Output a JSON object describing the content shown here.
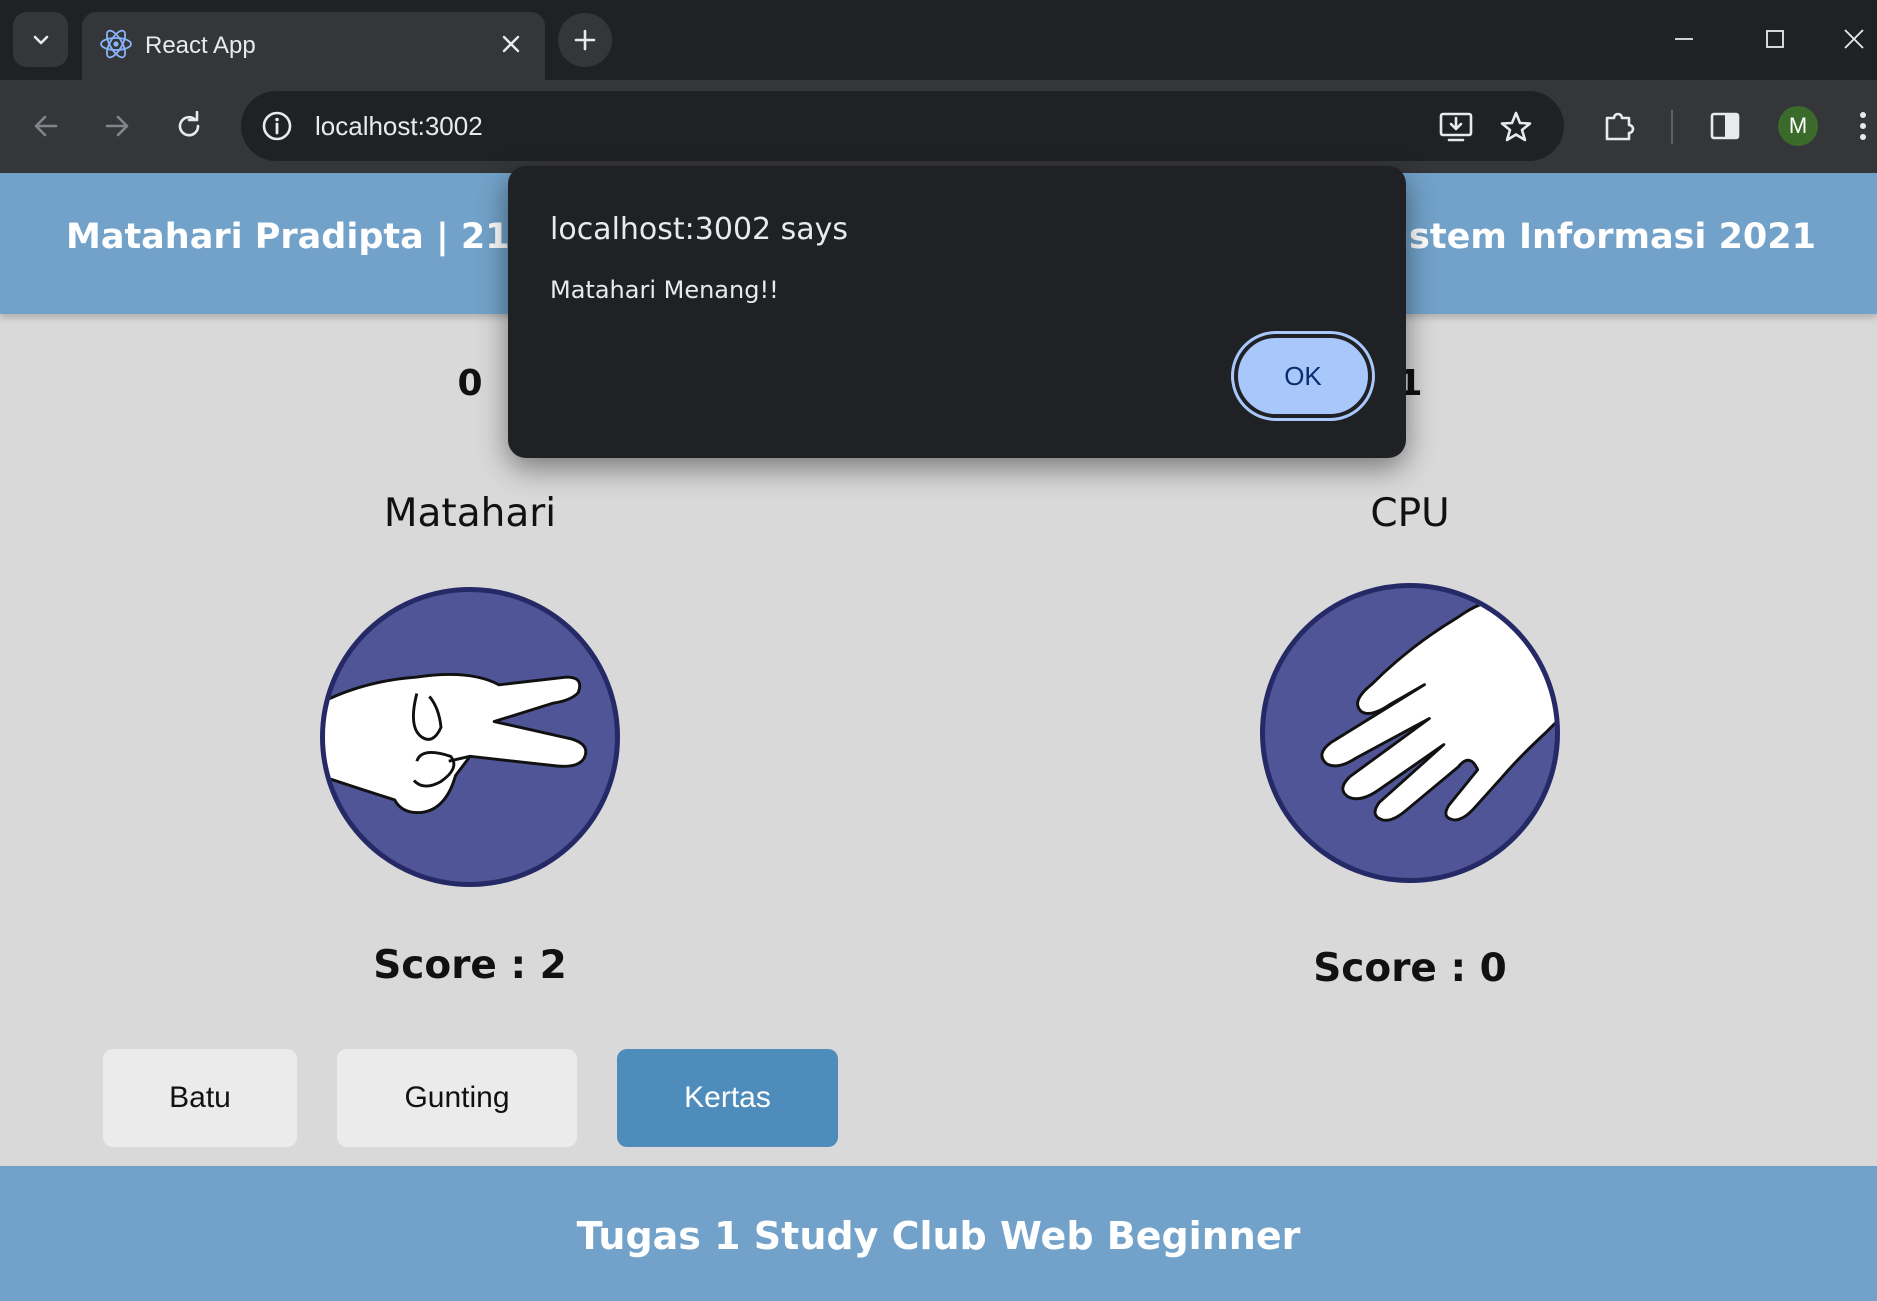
{
  "browser": {
    "tab_title": "React App",
    "url": "localhost:3002",
    "profile_initial": "M",
    "icons": [
      "tab-list-icon",
      "react-favicon-icon",
      "close-tab-icon",
      "new-tab-icon",
      "minimize-icon",
      "maximize-icon",
      "close-window-icon",
      "back-icon",
      "forward-icon",
      "reload-icon",
      "site-info-icon",
      "install-app-icon",
      "bookmark-star-icon",
      "extensions-icon",
      "side-panel-icon",
      "more-menu-icon"
    ]
  },
  "header": {
    "left_text": "Matahari Pradipta | 2110512",
    "right_text": "S1 Sistem Informasi 2021"
  },
  "game": {
    "player": {
      "top_count": "0",
      "name": "Matahari",
      "hand": "scissors",
      "score_text": "Score : 2"
    },
    "cpu": {
      "top_count": "1",
      "name": "CPU",
      "hand": "paper",
      "score_text": "Score : 0"
    },
    "buttons": [
      {
        "label": "Batu",
        "active": false
      },
      {
        "label": "Gunting",
        "active": false
      },
      {
        "label": "Kertas",
        "active": true
      }
    ]
  },
  "footer": {
    "text": "Tugas 1 Study Club Web Beginner"
  },
  "dialog": {
    "title": "localhost:3002 says",
    "message": "Matahari Menang!!",
    "ok_label": "OK"
  },
  "colors": {
    "header_bg": "#72a2c9",
    "page_bg": "#d9d9d9",
    "active_button": "#4e8cbb",
    "circle_fill": "#4f5597",
    "dialog_bg": "#202124",
    "ok_button": "#a8c7fa"
  }
}
